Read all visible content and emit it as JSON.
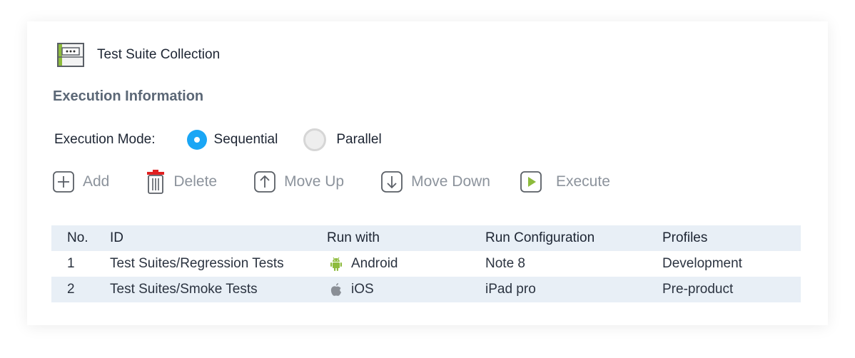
{
  "header": {
    "title": "Test Suite Collection",
    "icon": "test-suite-collection-icon"
  },
  "section_title": "Execution Information",
  "execution_mode": {
    "label": "Execution Mode:",
    "options": [
      {
        "label": "Sequential",
        "selected": true
      },
      {
        "label": "Parallel",
        "selected": false
      }
    ]
  },
  "toolbar": {
    "add": "Add",
    "delete": "Delete",
    "move_up": "Move Up",
    "move_down": "Move Down",
    "execute": "Execute"
  },
  "table": {
    "headers": [
      "No.",
      "ID",
      "Run with",
      "Run Configuration",
      "Profiles"
    ],
    "rows": [
      {
        "no": "1",
        "id": "Test Suites/Regression Tests",
        "run_with": "Android",
        "run_with_icon": "android-icon",
        "config": "Note 8",
        "profile": "Development"
      },
      {
        "no": "2",
        "id": "Test Suites/Smoke Tests",
        "run_with": "iOS",
        "run_with_icon": "apple-icon",
        "config": "iPad pro",
        "profile": "Pre-product"
      }
    ]
  },
  "colors": {
    "accent": "#1aa6f5",
    "header_row": "#e8eff6",
    "android": "#8dbb3c",
    "execute": "#8dbb3c"
  }
}
